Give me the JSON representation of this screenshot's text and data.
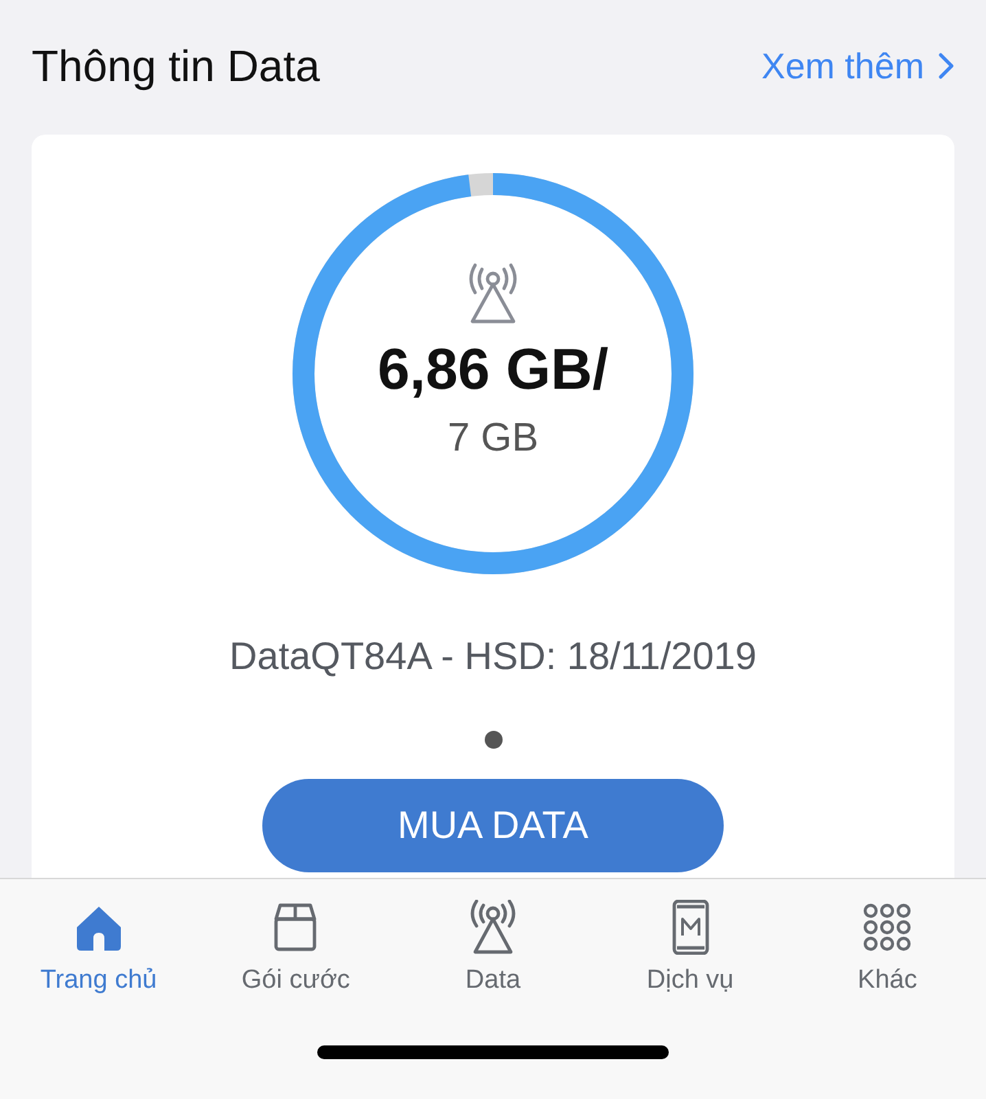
{
  "header": {
    "title": "Thông tin Data",
    "more_link": "Xem thêm"
  },
  "data_card": {
    "used": "6,86 GB/",
    "total": "7 GB",
    "package": "DataQT84A - HSD: 18/11/2019",
    "pager_dots": [
      {
        "selected": true
      }
    ],
    "buy_button": "MUA DATA"
  },
  "tab_bar": [
    {
      "label": "Trang chủ",
      "kind": "home",
      "selected": true
    },
    {
      "label": "Gói cước",
      "kind": "box",
      "selected": false
    },
    {
      "label": "Data",
      "kind": "antenna",
      "selected": false
    },
    {
      "label": "Dịch vụ",
      "kind": "phone",
      "selected": false
    },
    {
      "label": "Khác",
      "kind": "grid",
      "selected": false
    }
  ]
}
